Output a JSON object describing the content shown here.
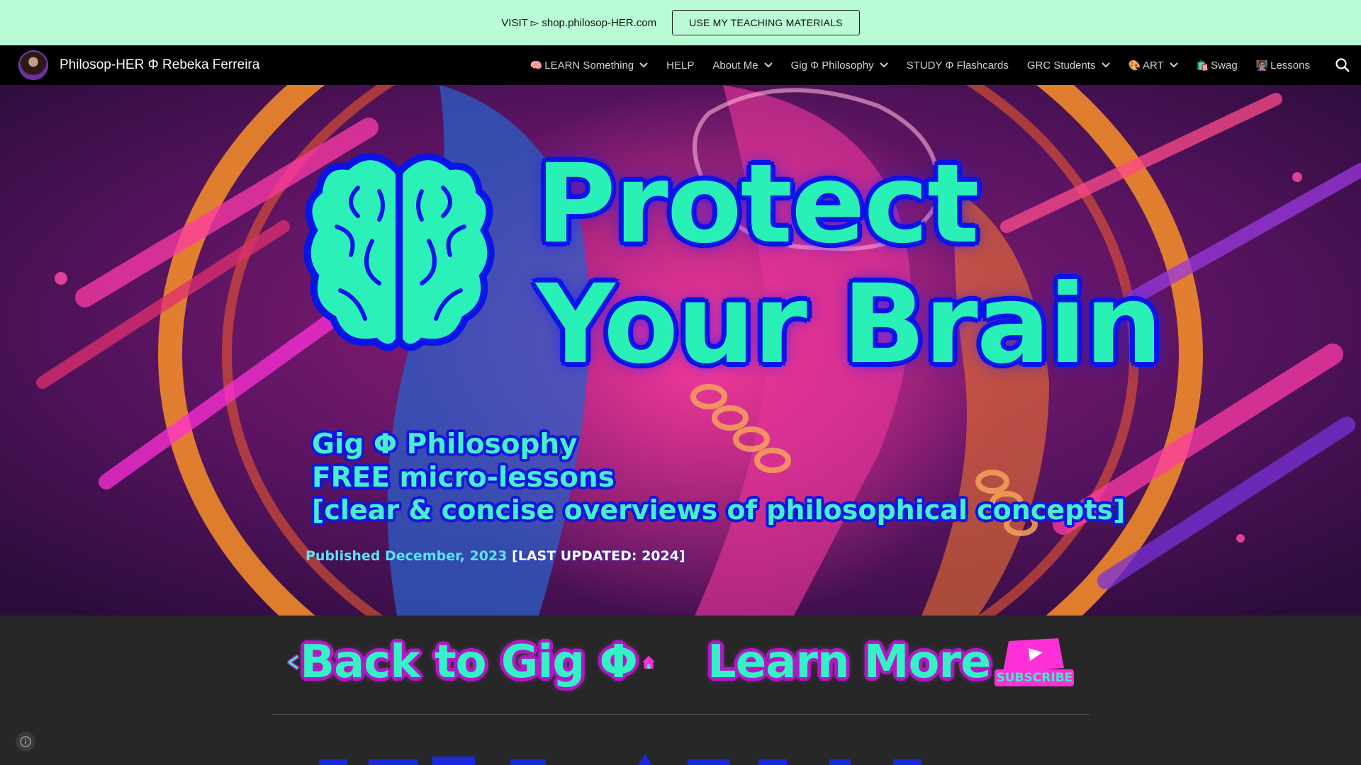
{
  "announcement": {
    "text": "VISIT ▻ shop.philosop-HER.com",
    "button": "USE MY TEACHING MATERIALS"
  },
  "site": {
    "title": "Philosop-HER Φ Rebeka Ferreira"
  },
  "nav": {
    "items": [
      {
        "label": "LEARN Something",
        "emoji": "🧠",
        "dropdown": true
      },
      {
        "label": "HELP",
        "emoji": "",
        "dropdown": false
      },
      {
        "label": "About Me",
        "emoji": "",
        "dropdown": true
      },
      {
        "label": "Gig Φ Philosophy",
        "emoji": "",
        "dropdown": true
      },
      {
        "label": "STUDY Φ Flashcards",
        "emoji": "",
        "dropdown": false
      },
      {
        "label": "GRC Students",
        "emoji": "",
        "dropdown": true
      },
      {
        "label": "ART",
        "emoji": "🎨",
        "dropdown": true
      },
      {
        "label": "Swag",
        "emoji": "🛍️",
        "dropdown": false
      },
      {
        "label": "Lessons",
        "emoji": "👩🏽‍🏫",
        "dropdown": false
      }
    ]
  },
  "hero": {
    "headline_line1": "Protect",
    "headline_line2": "Your Brain",
    "sub_line1": "Gig Φ Philosophy",
    "sub_line2": "FREE micro-lessons",
    "sub_line3": "[clear & concise overviews of philosophical concepts]",
    "published": "Published December, 2023",
    "updated": "[LAST UPDATED: 2024]"
  },
  "buttons": {
    "back": "Back to Gig Φ",
    "learn": "Learn More",
    "subscribe": "SUBSCRIBE"
  },
  "colors": {
    "announce_bg": "#b9fbd5",
    "nav_bg": "#000000",
    "mint": "#29f0b5",
    "blue_outline": "#0814e8",
    "magenta": "#ff2fd8",
    "page_bg": "#272727"
  }
}
